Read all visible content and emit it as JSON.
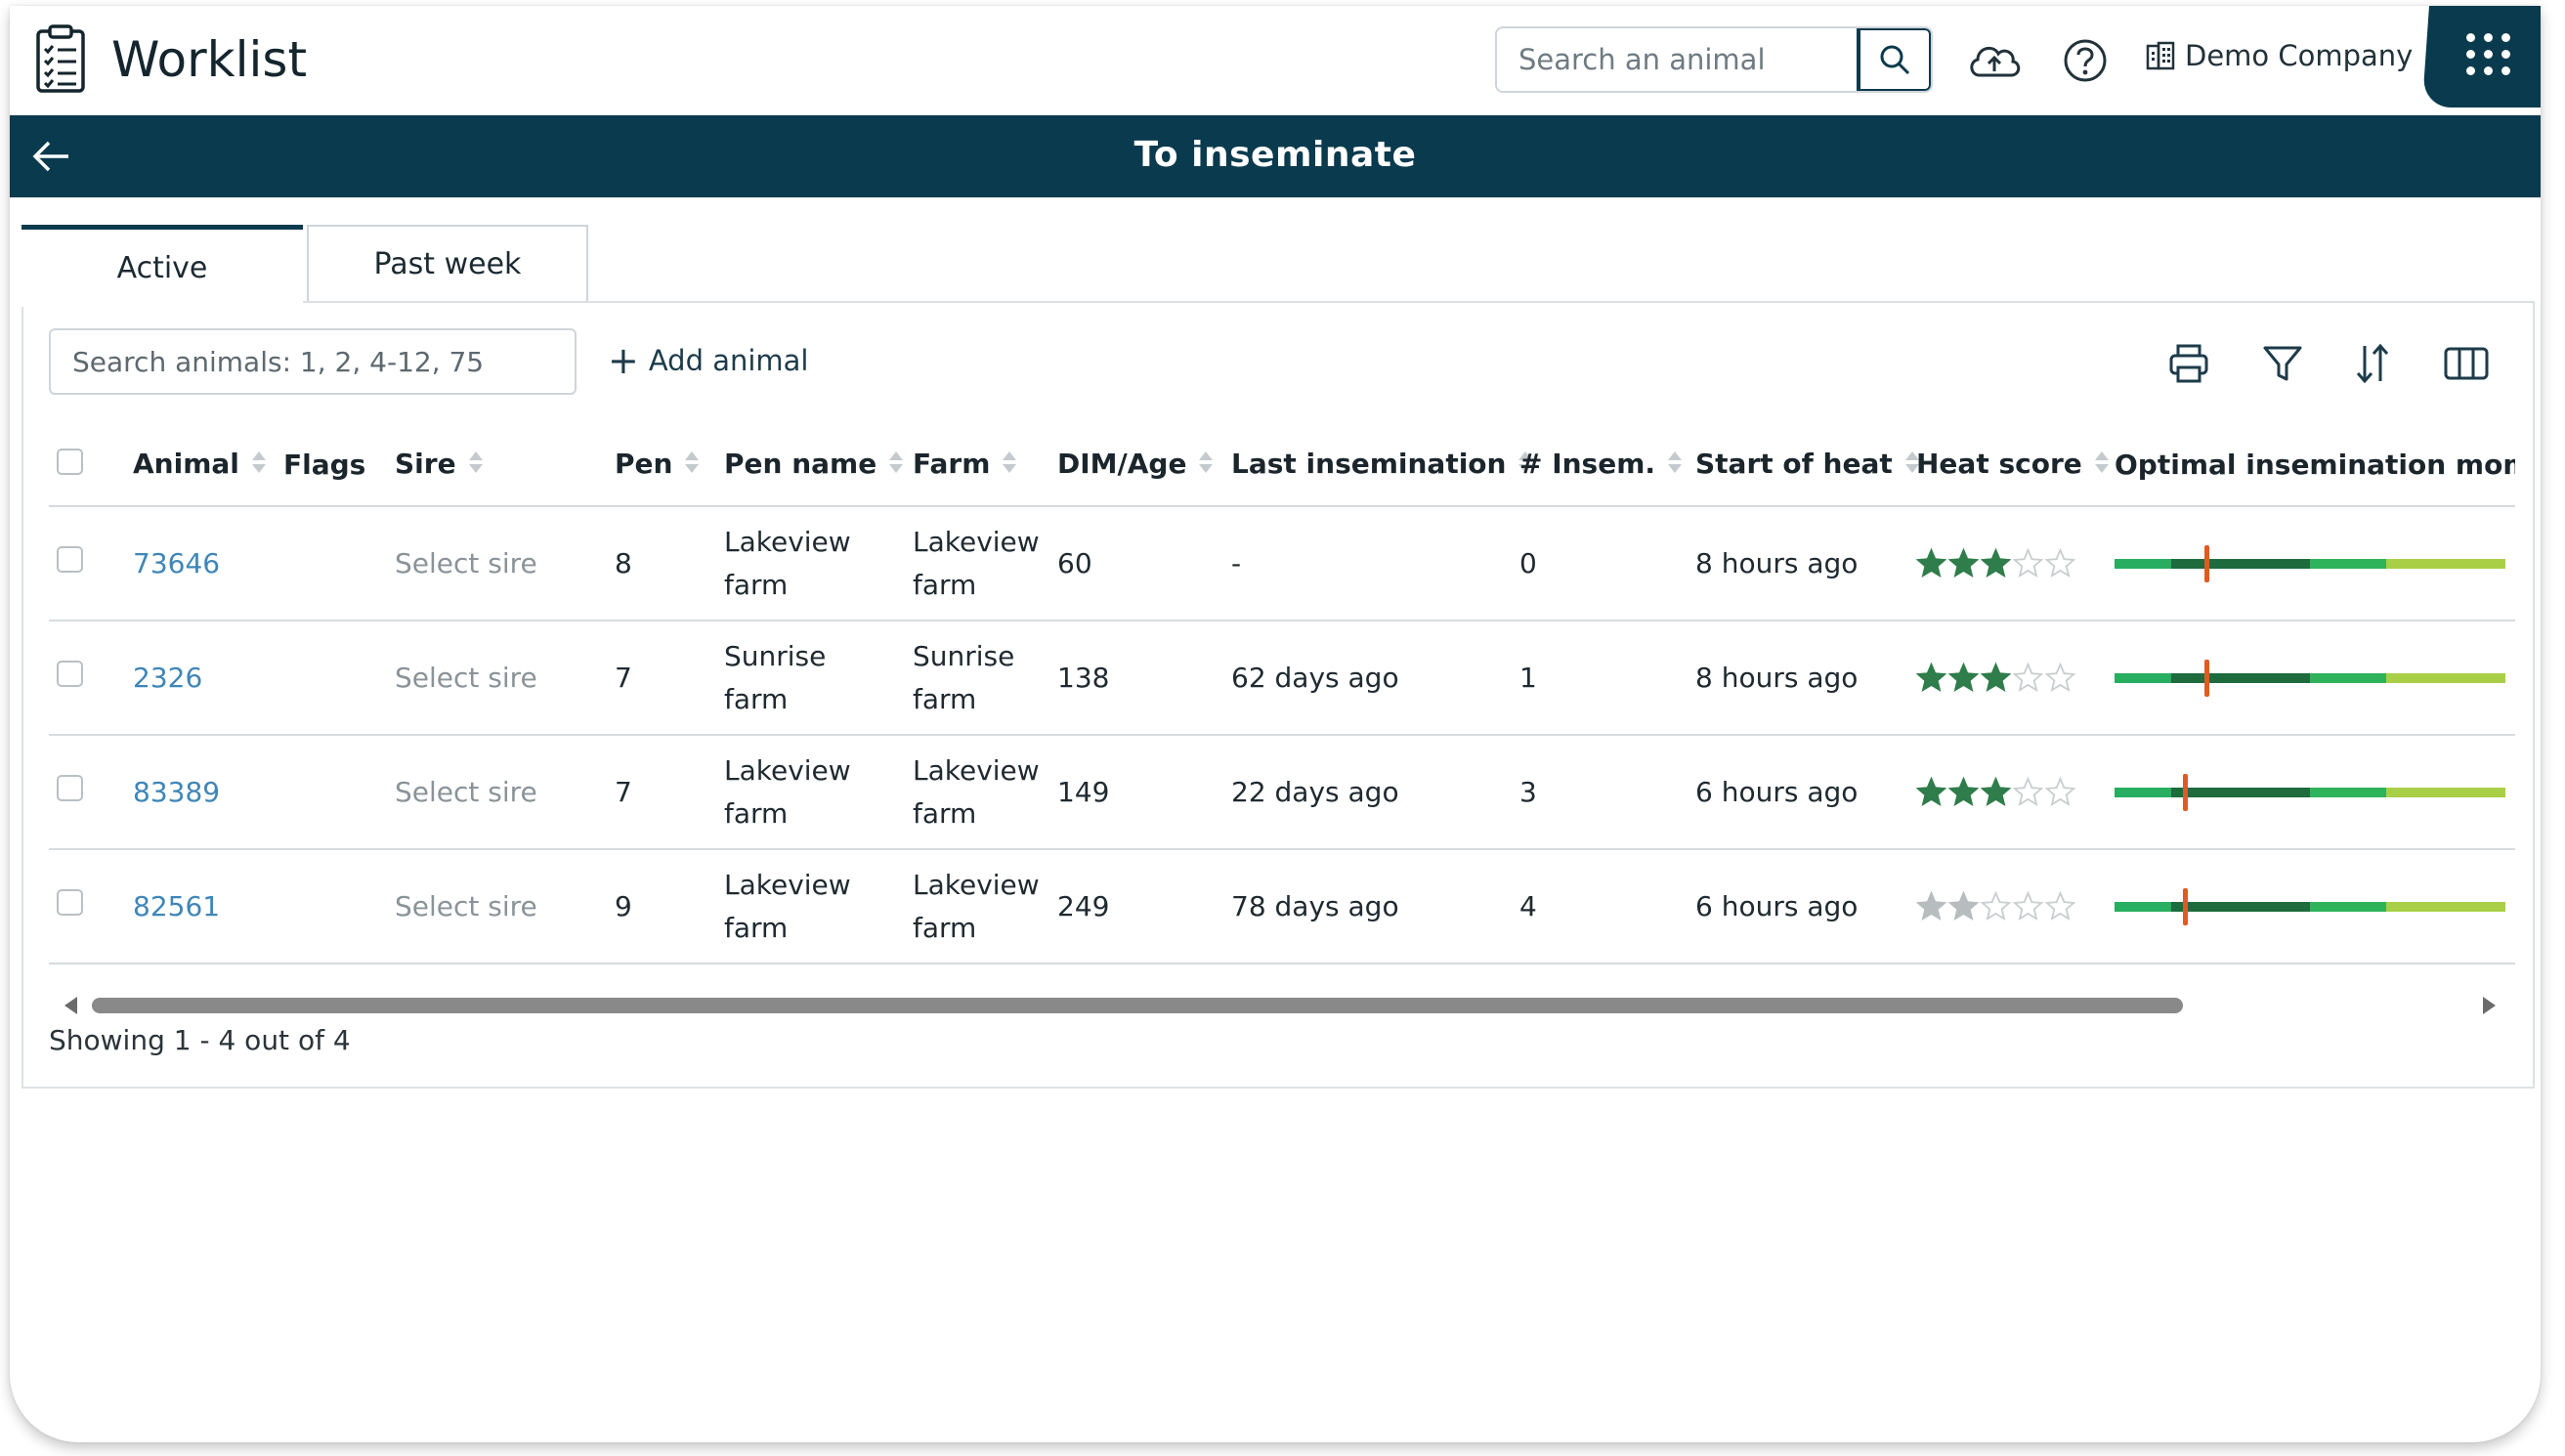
{
  "header": {
    "app_title": "Worklist",
    "search_placeholder": "Search an animal",
    "company": "Demo Company"
  },
  "titlebar": {
    "title": "To inseminate"
  },
  "tabs": [
    {
      "label": "Active",
      "active": true
    },
    {
      "label": "Past week",
      "active": false
    }
  ],
  "toolbar": {
    "filter_placeholder": "Search animals: 1, 2, 4-12, 75",
    "add_animal": "Add animal",
    "tools": [
      "print-icon",
      "filter-icon",
      "sort-icon",
      "columns-icon"
    ]
  },
  "table": {
    "columns": [
      "Animal",
      "Flags",
      "Sire",
      "Pen",
      "Pen name",
      "Farm",
      "DIM/Age",
      "Last insemination",
      "# Insem.",
      "Start of heat",
      "Heat score",
      "Optimal insemination moment"
    ],
    "rows": [
      {
        "animal": "73646",
        "sire": "Select sire",
        "pen": "8",
        "pen_name_1": "Lakeview",
        "pen_name_2": "farm",
        "farm_1": "Lakeview",
        "farm_2": "farm",
        "dim": "60",
        "last_insemination": "-",
        "insem": "0",
        "start_of_heat": "8 hours ago",
        "heat_score": 3,
        "optimal_marker": 0.235
      },
      {
        "animal": "2326",
        "sire": "Select sire",
        "pen": "7",
        "pen_name_1": "Sunrise",
        "pen_name_2": "farm",
        "farm_1": "Sunrise",
        "farm_2": "farm",
        "dim": "138",
        "last_insemination": "62 days ago",
        "insem": "1",
        "start_of_heat": "8 hours ago",
        "heat_score": 3,
        "optimal_marker": 0.235
      },
      {
        "animal": "83389",
        "sire": "Select sire",
        "pen": "7",
        "pen_name_1": "Lakeview",
        "pen_name_2": "farm",
        "farm_1": "Lakeview",
        "farm_2": "farm",
        "dim": "149",
        "last_insemination": "22 days ago",
        "insem": "3",
        "start_of_heat": "6 hours ago",
        "heat_score": 3,
        "optimal_marker": 0.18
      },
      {
        "animal": "82561",
        "sire": "Select sire",
        "pen": "9",
        "pen_name_1": "Lakeview",
        "pen_name_2": "farm",
        "farm_1": "Lakeview",
        "farm_2": "farm",
        "dim": "249",
        "last_insemination": "78 days ago",
        "insem": "4",
        "start_of_heat": "6 hours ago",
        "heat_score": 2,
        "optimal_marker": 0.18
      }
    ]
  },
  "footer": {
    "showing": "Showing 1 - 4 out of 4"
  },
  "colors": {
    "brand": "#0a3a4d",
    "link": "#3f86b8",
    "star_on": "#2f7d4a",
    "marker": "#e15a23"
  }
}
